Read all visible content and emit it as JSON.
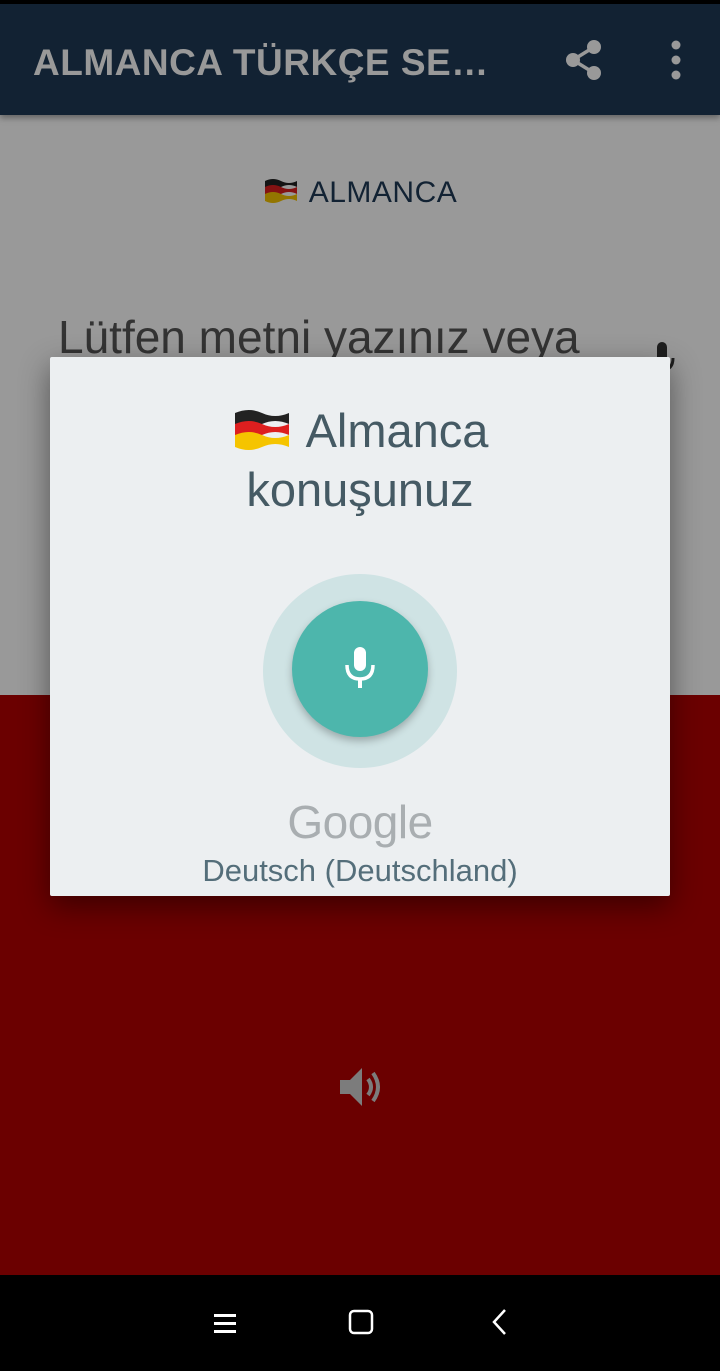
{
  "app_bar": {
    "title": "ALMANCA TÜRKÇE SES...",
    "share_icon": "share-icon",
    "more_icon": "more-vert-icon",
    "background": "#1e3a56"
  },
  "source": {
    "flag_icon": "germany-flag-icon",
    "language": "ALMANCA"
  },
  "input": {
    "placeholder": "Lütfen metni yazınız veya",
    "mic_icon": "microphone-icon"
  },
  "target_panel": {
    "background": "#b30000",
    "speaker_icon": "volume-up-icon"
  },
  "voice_dialog": {
    "flag_icon": "germany-flag-icon",
    "title_line1": "Almanca",
    "title_line2": "konuşunuz",
    "mic_icon": "microphone-icon",
    "mic_color": "#4db6ac",
    "provider": "Google",
    "locale": "Deutsch (Deutschland)"
  },
  "navbar": {
    "recents_icon": "recents-icon",
    "home_icon": "home-icon",
    "back_icon": "back-icon"
  }
}
